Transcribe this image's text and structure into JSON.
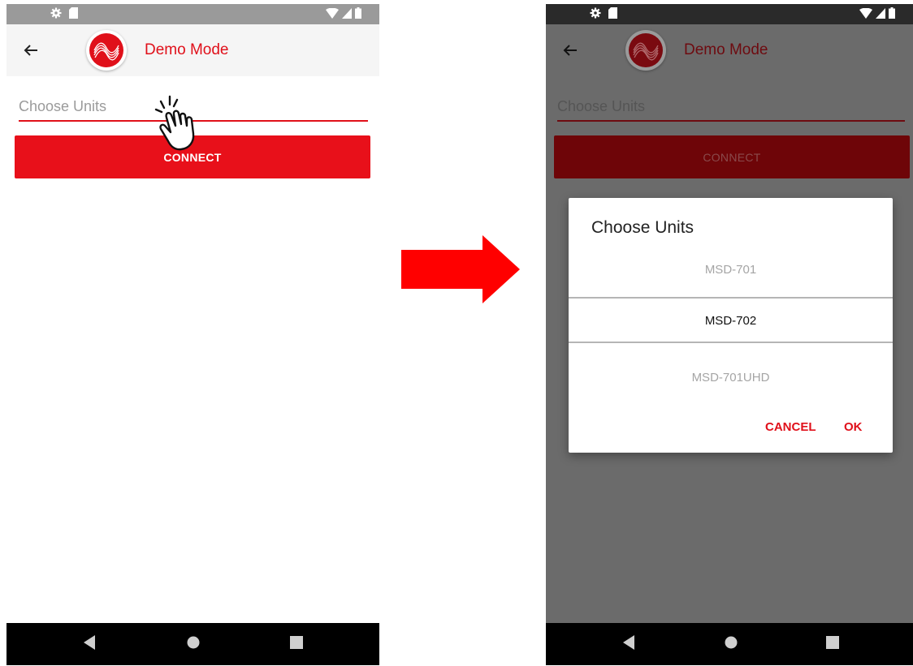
{
  "left_screen": {
    "app_bar": {
      "title": "Demo Mode"
    },
    "units_field": {
      "placeholder": "Choose Units"
    },
    "connect_button": {
      "label": "CONNECT"
    }
  },
  "right_screen": {
    "app_bar": {
      "title": "Demo Mode"
    },
    "units_field": {
      "placeholder": "Choose Units"
    },
    "connect_button": {
      "label": "CONNECT"
    },
    "dialog": {
      "title": "Choose Units",
      "options": [
        "MSD-701",
        "MSD-702",
        "MSD-701UHD"
      ],
      "selected": "MSD-702",
      "cancel_label": "CANCEL",
      "ok_label": "OK"
    }
  },
  "colors": {
    "accent": "#e0101a",
    "arrow": "#ff0000",
    "scrim": "#6b6b6b",
    "nav_bar": "#000000"
  },
  "icons": {
    "status": [
      "settings-icon",
      "sd-card-icon",
      "wifi-icon",
      "signal-icon",
      "battery-icon"
    ],
    "app_bar": [
      "back-arrow-icon",
      "logo-wave-icon"
    ],
    "nav": [
      "nav-back-icon",
      "nav-home-icon",
      "nav-recents-icon"
    ],
    "annotations": [
      "tap-hand-icon",
      "transition-arrow-icon"
    ]
  }
}
